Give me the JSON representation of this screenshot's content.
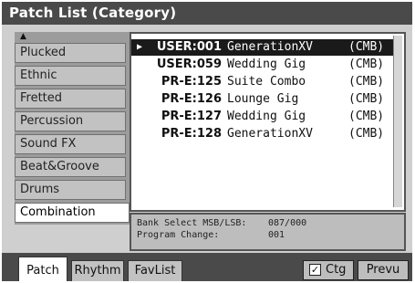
{
  "title": "Patch List (Category)",
  "categories": {
    "items": [
      "Plucked",
      "Ethnic",
      "Fretted",
      "Percussion",
      "Sound FX",
      "Beat&Groove",
      "Drums",
      "Combination"
    ],
    "selected": "Combination"
  },
  "patches": [
    {
      "bank": "USER:001",
      "name": "GenerationXV",
      "type": "(CMB)",
      "selected": true
    },
    {
      "bank": "USER:059",
      "name": "Wedding Gig",
      "type": "(CMB)",
      "selected": false
    },
    {
      "bank": "PR-E:125",
      "name": "Suite Combo",
      "type": "(CMB)",
      "selected": false
    },
    {
      "bank": "PR-E:126",
      "name": "Lounge Gig",
      "type": "(CMB)",
      "selected": false
    },
    {
      "bank": "PR-E:127",
      "name": "Wedding Gig",
      "type": "(CMB)",
      "selected": false
    },
    {
      "bank": "PR-E:128",
      "name": "GenerationXV",
      "type": "(CMB)",
      "selected": false
    }
  ],
  "info": {
    "bank_select_label": "Bank Select MSB/LSB:",
    "bank_select_value": "087/000",
    "program_change_label": "Program Change:",
    "program_change_value": "001"
  },
  "tabs": [
    "Patch",
    "Rhythm",
    "FavList"
  ],
  "active_tab": "Patch",
  "buttons": {
    "ctg_label": "Ctg",
    "ctg_checked": true,
    "prevu_label": "Prevu"
  },
  "icons": {
    "scroll_up": "triangle-up-icon",
    "selection_pointer": "triangle-right-icon",
    "check": "checkmark-icon"
  },
  "colors": {
    "titlebar": "#4a4a4a",
    "background": "#cfcfcf",
    "selection": "#1a1a1a"
  }
}
